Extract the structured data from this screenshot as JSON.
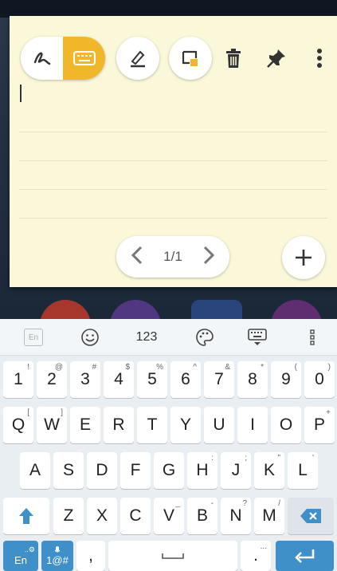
{
  "note": {
    "toolbar": {
      "handwriting_icon": "squiggle-pen-icon",
      "keyboard_icon": "keyboard-icon",
      "marker_icon": "highlighter-icon",
      "color_icon": "note-color-icon",
      "delete_icon": "trash-icon",
      "pin_icon": "pin-icon",
      "more_icon": "more-vertical-icon",
      "accent": "#f0b72a"
    },
    "pager": {
      "label": "1/1"
    }
  },
  "keyboard": {
    "topbar": {
      "lang": "En",
      "numbers": "123"
    },
    "rows": [
      [
        {
          "k": "1",
          "s": "!"
        },
        {
          "k": "2",
          "s": "@"
        },
        {
          "k": "3",
          "s": "#"
        },
        {
          "k": "4",
          "s": "$"
        },
        {
          "k": "5",
          "s": "%"
        },
        {
          "k": "6",
          "s": "^"
        },
        {
          "k": "7",
          "s": "&"
        },
        {
          "k": "8",
          "s": "*"
        },
        {
          "k": "9",
          "s": "("
        },
        {
          "k": "0",
          "s": ")"
        }
      ],
      [
        {
          "k": "Q",
          "s": "["
        },
        {
          "k": "W",
          "s": "]"
        },
        {
          "k": "E",
          "s": ""
        },
        {
          "k": "R",
          "s": ""
        },
        {
          "k": "T",
          "s": ""
        },
        {
          "k": "Y",
          "s": ""
        },
        {
          "k": "U",
          "s": ""
        },
        {
          "k": "I",
          "s": ""
        },
        {
          "k": "O",
          "s": ""
        },
        {
          "k": "P",
          "s": "+"
        }
      ],
      [
        {
          "k": "A",
          "s": ""
        },
        {
          "k": "S",
          "s": ""
        },
        {
          "k": "D",
          "s": ""
        },
        {
          "k": "F",
          "s": ""
        },
        {
          "k": "G",
          "s": ""
        },
        {
          "k": "H",
          "s": ":"
        },
        {
          "k": "J",
          "s": ";"
        },
        {
          "k": "K",
          "s": "\""
        },
        {
          "k": "L",
          "s": "'"
        }
      ],
      [
        {
          "k": "Z",
          "s": ""
        },
        {
          "k": "X",
          "s": ""
        },
        {
          "k": "C",
          "s": ""
        },
        {
          "k": "V",
          "s": "_"
        },
        {
          "k": "B",
          "s": "-"
        },
        {
          "k": "N",
          "s": "?"
        },
        {
          "k": "M",
          "s": "/"
        }
      ]
    ],
    "bottom": {
      "lang_key": "En",
      "lang_key_sup": "..⚙",
      "sym_key": "1@#",
      "comma": ",",
      "period": ".",
      "period_sup": "..."
    }
  }
}
